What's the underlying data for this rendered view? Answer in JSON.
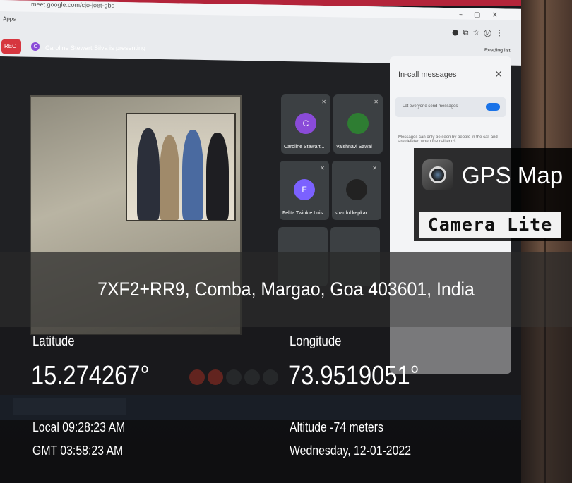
{
  "scene": {
    "browser_url": "meet.google.com/cjo-joet-gbd",
    "apps_label": "Apps",
    "reading_list": "Reading list",
    "rec_badge": "REC",
    "presenter_initial": "C",
    "presenting_text": "Caroline Stewart Silva is presenting",
    "chat_title": "In-call messages",
    "chat_toggle_label": "Let everyone send messages",
    "chat_note": "Messages can only be seen by people in the call and are deleted when the call ends",
    "participants": [
      {
        "name": "Caroline Stewart...",
        "initial": "C",
        "color": "#8a4bd8"
      },
      {
        "name": "Vaishnavi Sawal",
        "initial": "",
        "color": "#2e7d32"
      },
      {
        "name": "Felita Twinkle Luis",
        "initial": "F",
        "color": "#7b61ff"
      },
      {
        "name": "shardul kepkar",
        "initial": "",
        "color": "#222222"
      }
    ]
  },
  "logo": {
    "line1": "GPS Map",
    "line2": "Camera Lite"
  },
  "overlay": {
    "address": "7XF2+RR9, Comba, Margao, Goa 403601, India",
    "latitude_label": "Latitude",
    "latitude_value": "15.274267°",
    "longitude_label": "Longitude",
    "longitude_value": "73.9519051°",
    "local_time": "Local 09:28:23 AM",
    "gmt_time": "GMT 03:58:23 AM",
    "altitude": "Altitude -74 meters",
    "date": "Wednesday, 12-01-2022"
  }
}
